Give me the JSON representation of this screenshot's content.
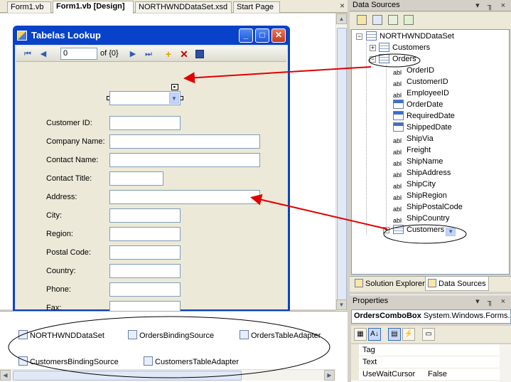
{
  "document_tabs": [
    {
      "label": "Form1.vb",
      "active": false
    },
    {
      "label": "Form1.vb [Design]",
      "active": true
    },
    {
      "label": "NORTHWNDDataSet.xsd",
      "active": false
    },
    {
      "label": "Start Page",
      "active": false
    }
  ],
  "tab_close_glyph": "×",
  "form": {
    "title": "Tabelas Lookup",
    "min_glyph": "_",
    "max_glyph": "□",
    "close_glyph": "✕"
  },
  "navigator": {
    "position": "0",
    "count_text": "of {0}",
    "add_glyph": "+",
    "delete_glyph": "✕"
  },
  "fields": [
    {
      "label": "Customer ID:",
      "width": "short"
    },
    {
      "label": "Company Name:",
      "width": "long"
    },
    {
      "label": "Contact Name:",
      "width": "long"
    },
    {
      "label": "Contact Title:",
      "width": "xshort"
    },
    {
      "label": "Address:",
      "width": "long"
    },
    {
      "label": "City:",
      "width": "short"
    },
    {
      "label": "Region:",
      "width": "short"
    },
    {
      "label": "Postal Code:",
      "width": "short"
    },
    {
      "label": "Country:",
      "width": "short"
    },
    {
      "label": "Phone:",
      "width": "short"
    },
    {
      "label": "Fax:",
      "width": "short"
    }
  ],
  "tray": {
    "items": [
      {
        "label": "NORTHWNDDataSet",
        "icon": "dataset-icon"
      },
      {
        "label": "OrdersBindingSource",
        "icon": "binding-source-icon"
      },
      {
        "label": "OrdersTableAdapter",
        "icon": "table-adapter-icon"
      },
      {
        "label": "CustomersBindingSource",
        "icon": "binding-source-icon"
      },
      {
        "label": "CustomersTableAdapter",
        "icon": "table-adapter-icon"
      }
    ]
  },
  "data_sources": {
    "title": "Data Sources",
    "header_controls": "▾ ╖ ×",
    "tree": {
      "root": "NORTHWNDDataSet",
      "customers": "Customers",
      "orders": "Orders",
      "order_fields": [
        {
          "name": "OrderID",
          "icon": "abl"
        },
        {
          "name": "CustomerID",
          "icon": "abl"
        },
        {
          "name": "EmployeeID",
          "icon": "abl"
        },
        {
          "name": "OrderDate",
          "icon": "date"
        },
        {
          "name": "RequiredDate",
          "icon": "date"
        },
        {
          "name": "ShippedDate",
          "icon": "date"
        },
        {
          "name": "ShipVia",
          "icon": "abl"
        },
        {
          "name": "Freight",
          "icon": "abl"
        },
        {
          "name": "ShipName",
          "icon": "abl"
        },
        {
          "name": "ShipAddress",
          "icon": "abl"
        },
        {
          "name": "ShipCity",
          "icon": "abl"
        },
        {
          "name": "ShipRegion",
          "icon": "abl"
        },
        {
          "name": "ShipPostalCode",
          "icon": "abl"
        },
        {
          "name": "ShipCountry",
          "icon": "abl"
        }
      ],
      "nested_customers": "Customers"
    }
  },
  "pane_tabs": [
    {
      "label": "Solution Explorer",
      "active": false
    },
    {
      "label": "Data Sources",
      "active": true
    }
  ],
  "properties": {
    "title": "Properties",
    "header_controls": "▾ ╖ ×",
    "object_name": "OrdersComboBox",
    "object_type": "System.Windows.Forms.ComboBox",
    "rows": [
      {
        "name": "Tag",
        "value": ""
      },
      {
        "name": "Text",
        "value": ""
      },
      {
        "name": "UseWaitCursor",
        "value": "False"
      }
    ]
  },
  "colors": {
    "annotation_arrow": "#e00000",
    "form_frame": "#0842c8"
  }
}
